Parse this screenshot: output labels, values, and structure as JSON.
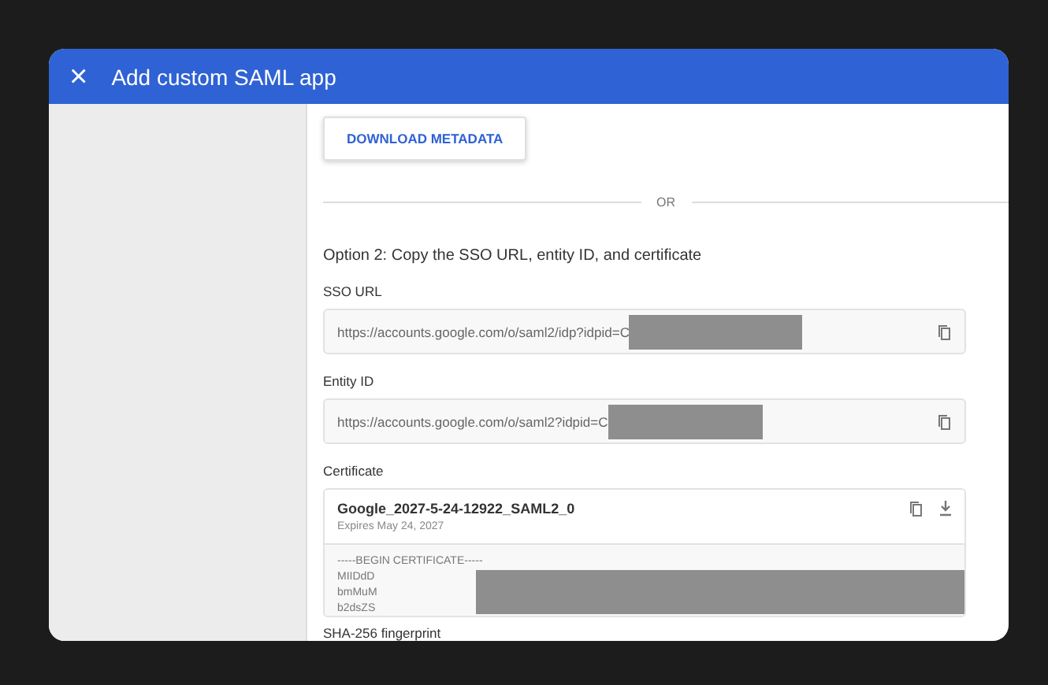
{
  "header": {
    "close": "×",
    "title": "Add custom SAML app"
  },
  "download_button": {
    "label": "DOWNLOAD METADATA"
  },
  "divider": {
    "label": "OR"
  },
  "section": {
    "title": "Option 2: Copy the SSO URL, entity ID, and certificate"
  },
  "fields": [
    {
      "label": "SSO URL",
      "value": "https://accounts.google.com/o/saml2/idp?idpid=C",
      "redacted": true
    },
    {
      "label": "Entity ID",
      "value": "https://accounts.google.com/o/saml2?idpid=C",
      "redacted": true
    }
  ],
  "certificate": {
    "label": "Certificate",
    "name": "Google_2027-5-24-12922_SAML2_0",
    "expires": "Expires May 24, 2027",
    "lines": [
      "-----BEGIN CERTIFICATE-----",
      "MIIDdD",
      "bmMuM",
      "b2dsZS"
    ],
    "redacted": true
  },
  "next_label": "SHA-256 fingerprint"
}
